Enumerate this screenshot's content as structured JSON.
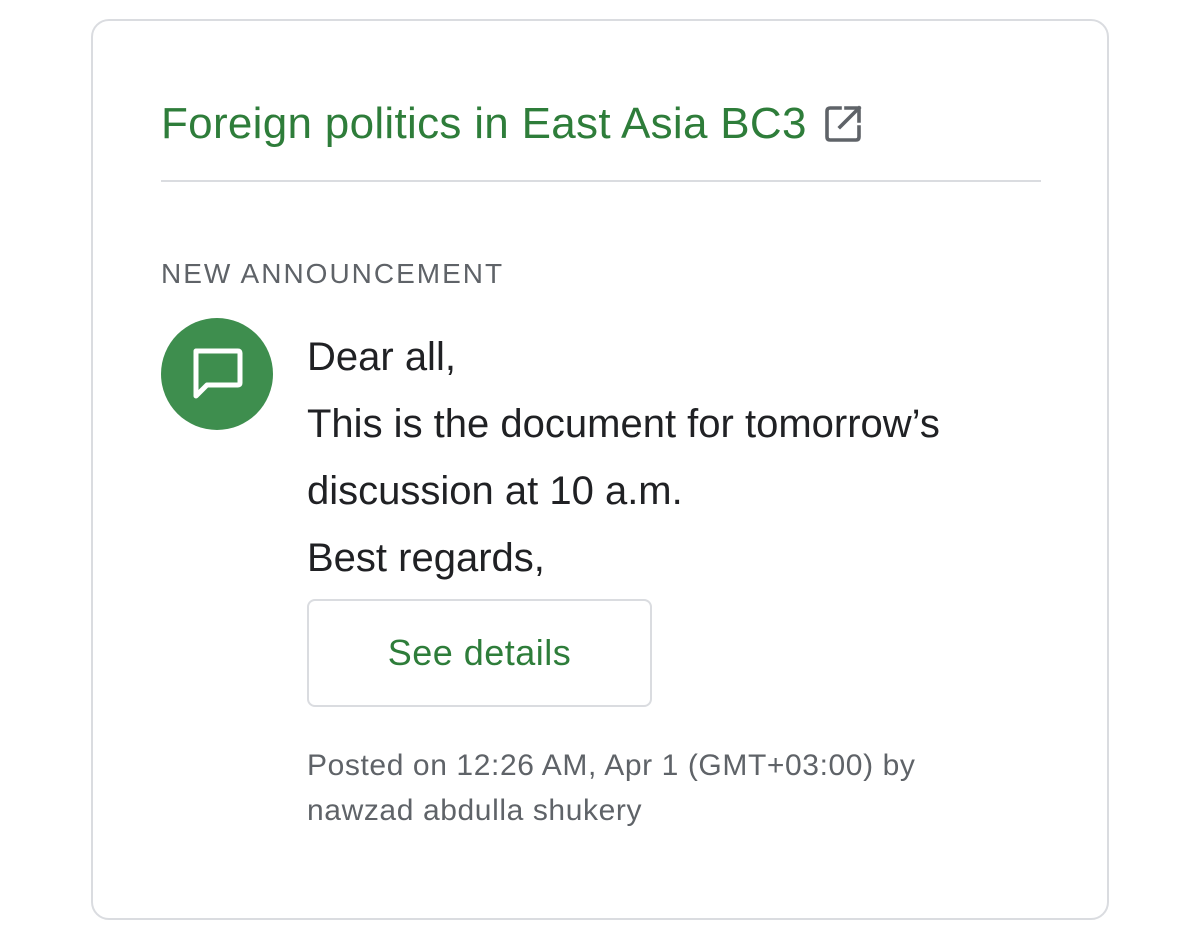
{
  "card": {
    "course_title": "Foreign politics in East Asia BC3",
    "open_icon": "open-in-new-icon",
    "section_label": "NEW ANNOUNCEMENT",
    "avatar_icon": "chat-bubble-icon",
    "message_lines": [
      "Dear all,",
      "This is the document for tomorrow’s",
      "discussion at 10 a.m.",
      "Best regards,"
    ],
    "details_button_label": "See details",
    "posted_lines": [
      "Posted on 12:26 AM, Apr 1 (GMT+03:00) by",
      "nawzad abdulla shukery"
    ]
  },
  "colors": {
    "accent": "#2e7d3a",
    "avatar_bg": "#3e8e4e",
    "border": "#dadce0",
    "text": "#202124",
    "muted": "#5f6368"
  }
}
